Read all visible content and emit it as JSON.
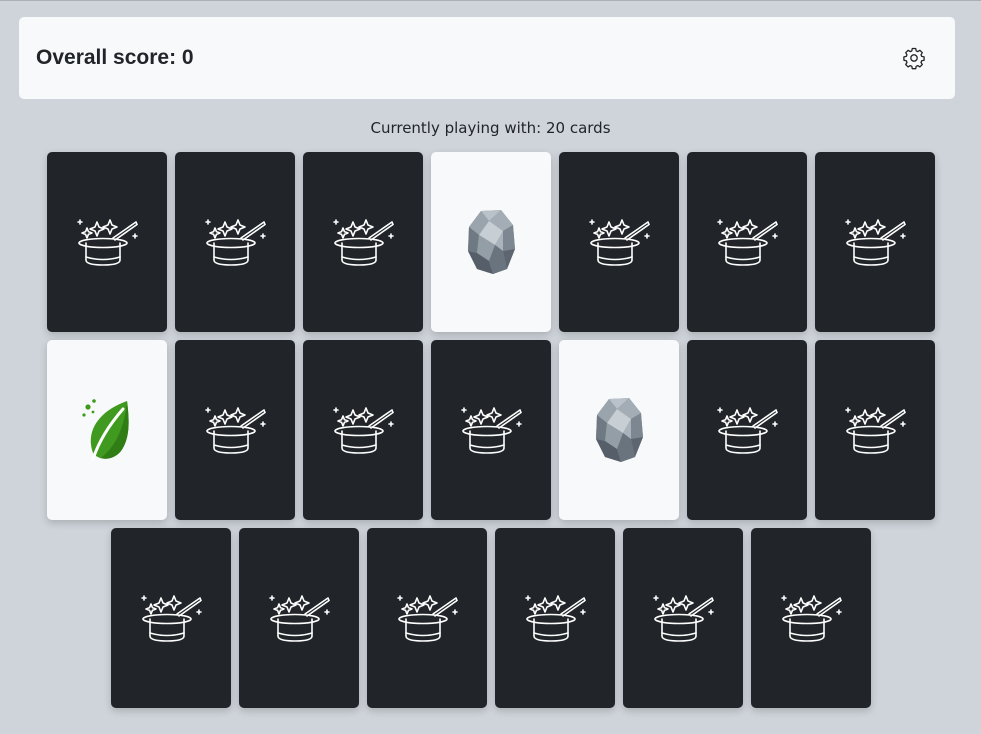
{
  "header": {
    "score_text": "Overall score: 0",
    "settings_icon": "gear-icon"
  },
  "status_text": "Currently playing with: 20 cards",
  "colors": {
    "background": "#ced4da",
    "card_back": "#212529",
    "card_face": "#f8f9fa",
    "leaf": "#3f9a1f",
    "stone": "#8a949e"
  },
  "board": {
    "rows": [
      [
        "magic-hat",
        "magic-hat",
        "magic-hat",
        "stone",
        "magic-hat",
        "magic-hat",
        "magic-hat"
      ],
      [
        "leaf",
        "magic-hat",
        "magic-hat",
        "magic-hat",
        "stone",
        "magic-hat",
        "magic-hat"
      ],
      [
        "magic-hat",
        "magic-hat",
        "magic-hat",
        "magic-hat",
        "magic-hat",
        "magic-hat"
      ]
    ]
  }
}
